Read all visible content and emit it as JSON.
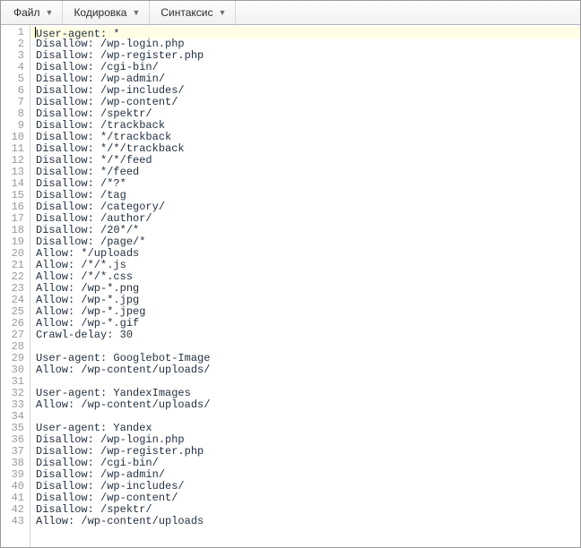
{
  "menubar": {
    "file": "Файл",
    "encoding": "Кодировка",
    "syntax": "Синтаксис"
  },
  "editor": {
    "current_line": 1,
    "lines": [
      "User-agent: *",
      "Disallow: /wp-login.php",
      "Disallow: /wp-register.php",
      "Disallow: /cgi-bin/",
      "Disallow: /wp-admin/",
      "Disallow: /wp-includes/",
      "Disallow: /wp-content/",
      "Disallow: /spektr/",
      "Disallow: /trackback",
      "Disallow: */trackback",
      "Disallow: */*/trackback",
      "Disallow: */*/feed",
      "Disallow: */feed",
      "Disallow: /*?*",
      "Disallow: /tag",
      "Disallow: /category/",
      "Disallow: /author/",
      "Disallow: /20*/*",
      "Disallow: /page/*",
      "Allow: */uploads",
      "Allow: /*/*.js",
      "Allow: /*/*.css",
      "Allow: /wp-*.png",
      "Allow: /wp-*.jpg",
      "Allow: /wp-*.jpeg",
      "Allow: /wp-*.gif",
      "Crawl-delay: 30",
      "",
      "User-agent: Googlebot-Image",
      "Allow: /wp-content/uploads/",
      "",
      "User-agent: YandexImages",
      "Allow: /wp-content/uploads/",
      "",
      "User-agent: Yandex",
      "Disallow: /wp-login.php",
      "Disallow: /wp-register.php",
      "Disallow: /cgi-bin/",
      "Disallow: /wp-admin/",
      "Disallow: /wp-includes/",
      "Disallow: /wp-content/",
      "Disallow: /spektr/",
      "Allow: /wp-content/uploads"
    ]
  }
}
